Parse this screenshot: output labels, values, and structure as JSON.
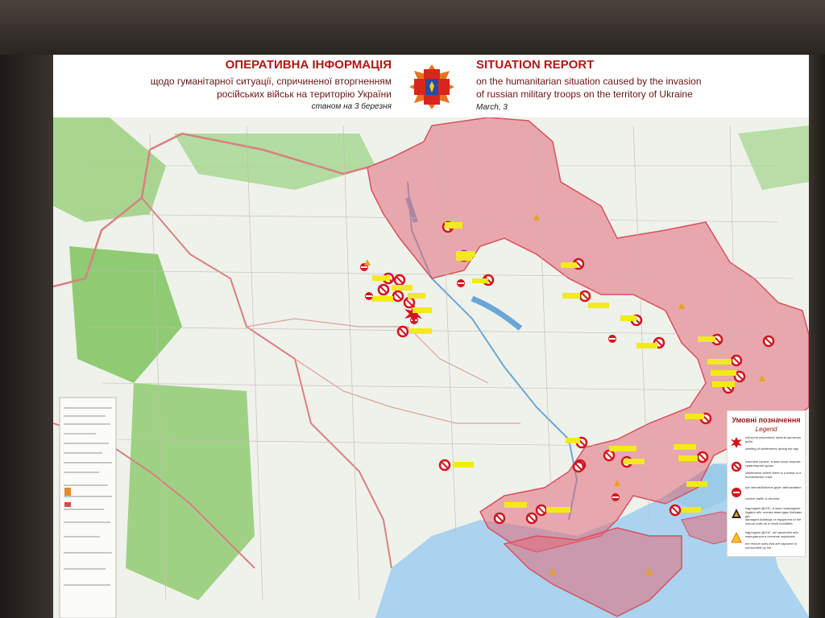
{
  "header": {
    "ua_title": "ОПЕРАТИВНА ІНФОРМАЦІЯ",
    "ua_sub1": "щодо гуманітарної ситуації, спричиненої вторгненням",
    "ua_sub2": "російських військ на територію України",
    "ua_date": "станом на 3 березня",
    "en_title": "SITUATION REPORT",
    "en_sub1": "on the humanitarian situation caused by the invasion",
    "en_sub2": "of russian military troops on the territory of Ukraine",
    "en_date": "March, 3",
    "emblem_icon": "dsns-emblem-icon"
  },
  "legend": {
    "title": "Умовні позначення",
    "subtitle": "Legend",
    "items": [
      {
        "icon": "shelling-burst-icon",
        "ua": "обстріли населених пунктів протягом доби",
        "en": "shelling of settlements during the day"
      },
      {
        "icon": "humanitarian-crisis-icon",
        "ua": "населені пункти, в яких існує загроза гуманітарної кризи",
        "en": "settlements where there is a threat of a humanitarian crisis"
      },
      {
        "icon": "traffic-blocked-icon",
        "ua": "рух автомобільних доріг заблоковано",
        "en": "vehicle traffic is blocked"
      },
      {
        "icon": "damaged-building-icon",
        "ua": "підрозділи ДСНС, в яких пошкоджені будівлі або техніка внаслідок бойових дій",
        "en": "damaged buildings or equipment of the rescue units as a result hostilities"
      },
      {
        "icon": "rescue-unit-warning-icon",
        "ua": "підрозділи ДСНС, які захоплені або знаходяться в оточенні окупантів",
        "en": "the rescue units that are captured or surrounded by the"
      }
    ]
  },
  "colors": {
    "occupied": "#e46a78",
    "sea": "#a9d3ee",
    "land": "#eef2ea",
    "forest": "#8fcb72",
    "marker": "#d2141e",
    "label": "#f2ea1a",
    "title_red": "#b01818"
  }
}
